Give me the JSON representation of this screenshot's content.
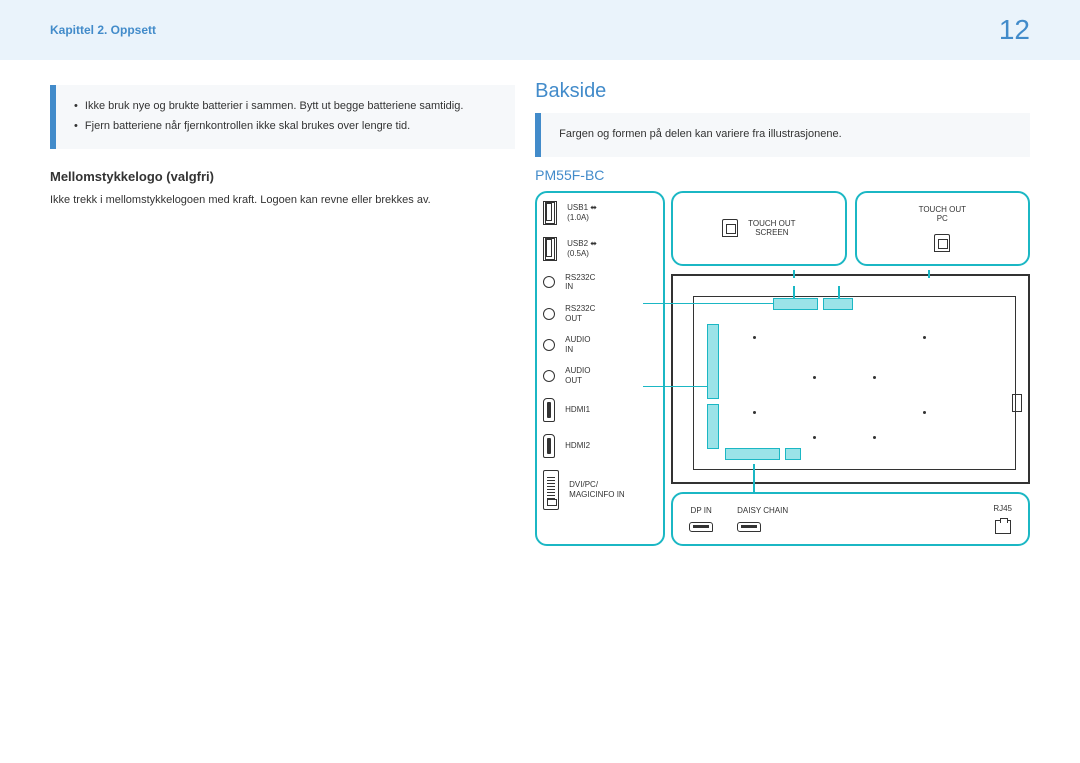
{
  "header": {
    "chapter": "Kapittel 2. Oppsett",
    "page": "12"
  },
  "infobox": {
    "items": [
      "Ikke bruk nye og brukte batterier i sammen. Bytt ut begge batteriene samtidig.",
      "Fjern batteriene når fjernkontrollen ikke skal brukes over lengre tid."
    ]
  },
  "left": {
    "subheading": "Mellomstykkelogo (valgfri)",
    "body": "Ikke trekk i mellomstykkelogoen med kraft. Logoen kan revne eller brekkes av."
  },
  "right": {
    "heading": "Bakside",
    "note": "Fargen og formen på delen kan variere fra illustrasjonene.",
    "model": "PM55F-BC"
  },
  "ports": {
    "usb1": "USB1 ⬌\n(1.0A)",
    "usb2": "USB2 ⬌\n(0.5A)",
    "rs232c_in": "RS232C\nIN",
    "rs232c_out": "RS232C\nOUT",
    "audio_in": "AUDIO\nIN",
    "audio_out": "AUDIO\nOUT",
    "hdmi1": "HDMI1",
    "hdmi2": "HDMI2",
    "dvi": "DVI/PC/\nMAGICINFO IN",
    "touch_out_screen": "TOUCH OUT\nSCREEN",
    "touch_out_pc": "TOUCH OUT\nPC",
    "dp_in": "DP IN",
    "daisy_chain": "DAISY CHAIN",
    "rj45": "RJ45"
  }
}
